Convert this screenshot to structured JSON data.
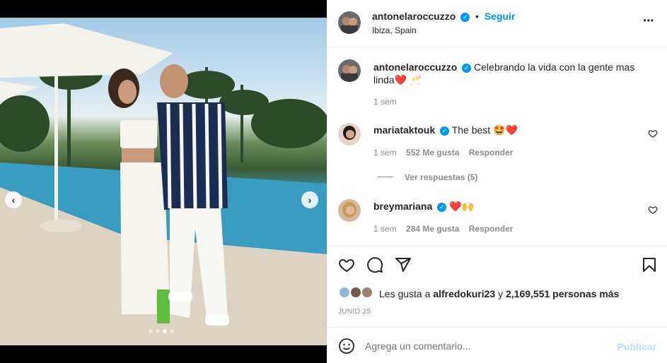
{
  "post": {
    "author": "antonelaroccuzzo",
    "follow_label": "Seguir",
    "location": "Ibiza, Spain",
    "more_label": "•••",
    "caption_user": "antonelaroccuzzo",
    "caption_text": "Celebrando la vida con la gente mas linda❤️ 🥂",
    "caption_time": "1 sem",
    "carousel": {
      "total": 4,
      "current": 3
    }
  },
  "comments": [
    {
      "user": "mariataktouk",
      "text": "The best 🤩❤️",
      "time": "1 sem",
      "likes": "552 Me gusta",
      "reply_label": "Responder",
      "view_replies": "Ver respuestas (5)"
    },
    {
      "user": "breymariana",
      "text": "❤️🙌",
      "time": "1 sem",
      "likes": "284 Me gusta",
      "reply_label": "Responder"
    }
  ],
  "likes": {
    "prefix": "Les gusta a",
    "user": "alfredokuri23",
    "joiner": "y",
    "count": "2,169,551 personas más",
    "date": "JUNIO 25"
  },
  "composer": {
    "placeholder": "Agrega un comentario...",
    "publish_label": "Publicar"
  },
  "icons": {
    "like": "heart-icon",
    "comment": "comment-icon",
    "share": "paper-plane-icon",
    "save": "bookmark-icon",
    "emoji": "emoji-icon",
    "verified": "verified-badge-icon"
  },
  "colors": {
    "accent": "#0095f6",
    "text": "#262626",
    "muted": "#8e8e8e"
  }
}
